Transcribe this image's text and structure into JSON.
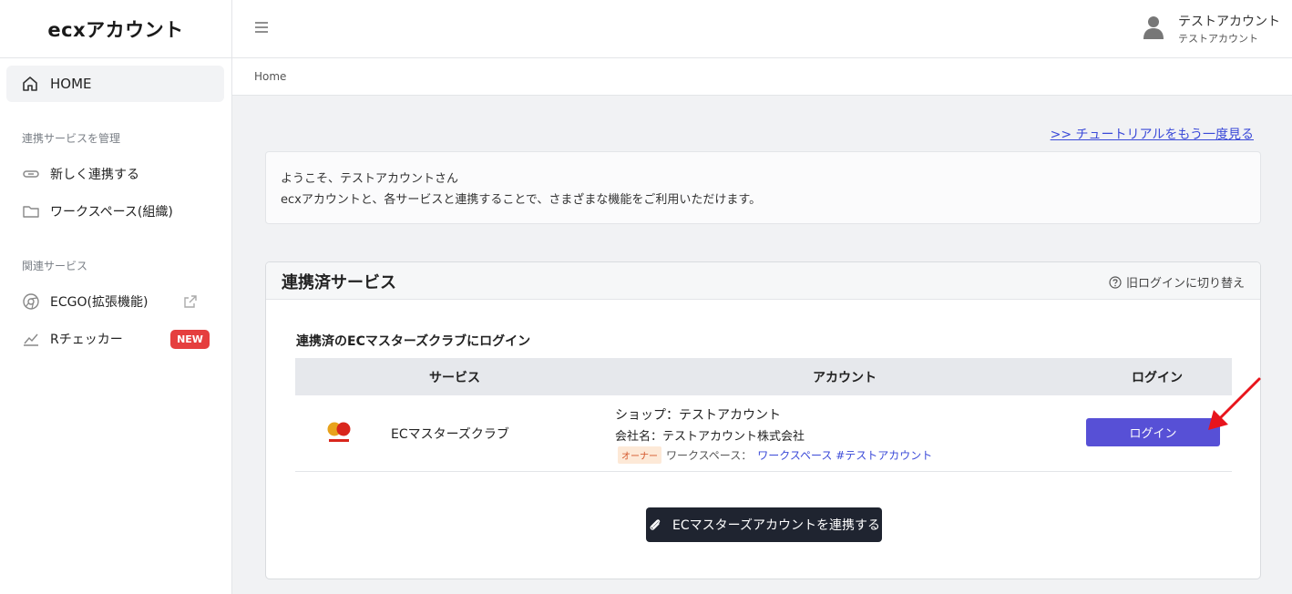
{
  "app": {
    "logo": "ecxアカウント"
  },
  "sidebar": {
    "home": "HOME",
    "manage_label": "連携サービスを管理",
    "items_manage": [
      {
        "label": "新しく連携する",
        "icon": "link-icon"
      },
      {
        "label": "ワークスペース(組織)",
        "icon": "folder-icon"
      }
    ],
    "related_label": "関連サービス",
    "items_related": [
      {
        "label": "ECGO(拡張機能)",
        "icon": "chrome-icon"
      },
      {
        "label": "Rチェッカー",
        "icon": "chart-line-icon",
        "badge": "NEW"
      }
    ]
  },
  "header": {
    "user_name": "テストアカウント",
    "user_sub": "テストアカウント"
  },
  "breadcrumb": "Home",
  "main": {
    "tutorial_link": ">> チュートリアルをもう一度見る",
    "welcome_line1": "ようこそ、テストアカウントさん",
    "welcome_line2": "ecxアカウントと、各サービスと連携することで、さまざまな機能をご利用いただけます。",
    "card": {
      "title": "連携済サービス",
      "old_login": "旧ログインに切り替え",
      "subtitle": "連携済のECマスターズクラブにログイン",
      "columns": [
        "サービス",
        "アカウント",
        "ログイン"
      ],
      "rows": [
        {
          "service": "ECマスターズクラブ",
          "shop": "ショップ：テストアカウント",
          "company": "会社名：テストアカウント株式会社",
          "owner_badge": "オーナー",
          "workspace_label": "ワークスペース：",
          "workspace_link": "ワークスペース #テストアカウント",
          "login_label": "ログイン"
        }
      ],
      "connect_button": "ECマスターズアカウントを連携する"
    }
  },
  "colors": {
    "accent": "#5750d6",
    "link": "#3b4ad8",
    "badge_new": "#e53e3e",
    "dark_button": "#1f2430"
  }
}
